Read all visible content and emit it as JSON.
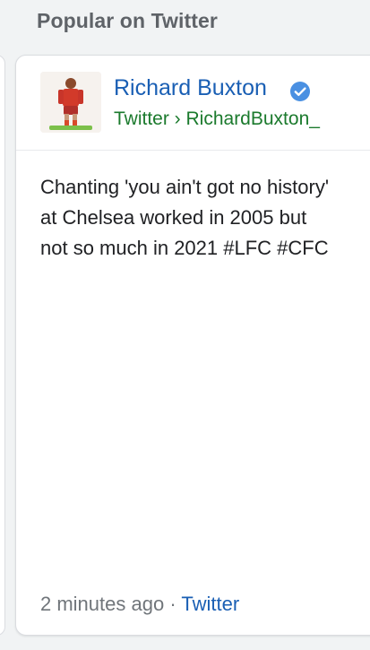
{
  "section": {
    "title": "Popular on Twitter"
  },
  "tweet": {
    "author_name": "Richard Buxton",
    "verified_icon": "verified-badge-icon",
    "source_line": "Twitter › RichardBuxton_",
    "text": "Chanting 'you ain't got no history' at Chelsea worked in 2005 but not so much in 2021 #LFC #CFC",
    "time_ago": "2 minutes ago",
    "separator": " · ",
    "source_link": "Twitter"
  },
  "colors": {
    "author_name": "#1a5fb4",
    "verified": "#4a90e2",
    "source_line": "#1b7a2d",
    "body_text": "#202124",
    "muted": "#70757a"
  }
}
